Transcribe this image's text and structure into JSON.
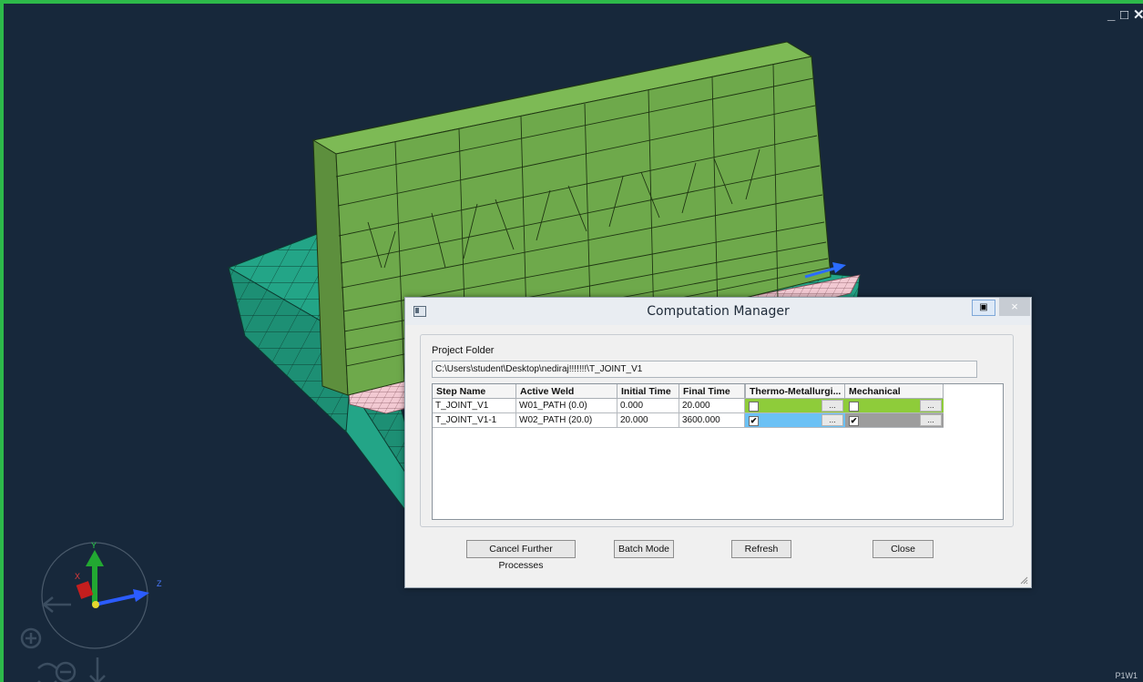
{
  "dialog": {
    "title": "Computation Manager",
    "restore_glyph": "▣",
    "close_glyph": "×",
    "project_folder_label": "Project Folder",
    "project_folder_value": "C:\\Users\\student\\Desktop\\nediraj!!!!!!!\\T_JOINT_V1",
    "columns": [
      "Step Name",
      "Active Weld",
      "Initial Time",
      "Final Time",
      "Thermo-Metallurgi...",
      "Mechanical"
    ],
    "rows": [
      {
        "step_name": "T_JOINT_V1",
        "active_weld": "W01_PATH (0.0)",
        "initial_time": "0.000",
        "final_time": "20.000",
        "thermo_checked": false,
        "mechanical_checked": false,
        "thermo_color": "#8ecc3a",
        "mechanical_color": "#8ecc3a"
      },
      {
        "step_name": "T_JOINT_V1-1",
        "active_weld": "W02_PATH (20.0)",
        "initial_time": "20.000",
        "final_time": "3600.000",
        "thermo_checked": true,
        "mechanical_checked": true,
        "thermo_color": "#6bc1f5",
        "mechanical_color": "#9d9d9d"
      }
    ],
    "ellipsis": "...",
    "check_mark": "✔",
    "buttons": {
      "cancel": "Cancel Further Processes",
      "batch": "Batch Mode",
      "refresh": "Refresh",
      "close": "Close"
    }
  },
  "viewport": {
    "window_controls": {
      "minimize": "_",
      "restore": "□",
      "close": "✕"
    },
    "corner_label": "P1W1",
    "axes": {
      "x": "X",
      "y": "Y",
      "z": "Z"
    },
    "colors": {
      "background": "#17283b",
      "border": "#2db94a",
      "web_plate": "#6ea94b",
      "base_plate": "#23a587",
      "weld_zone": "#f2c9d2"
    }
  }
}
